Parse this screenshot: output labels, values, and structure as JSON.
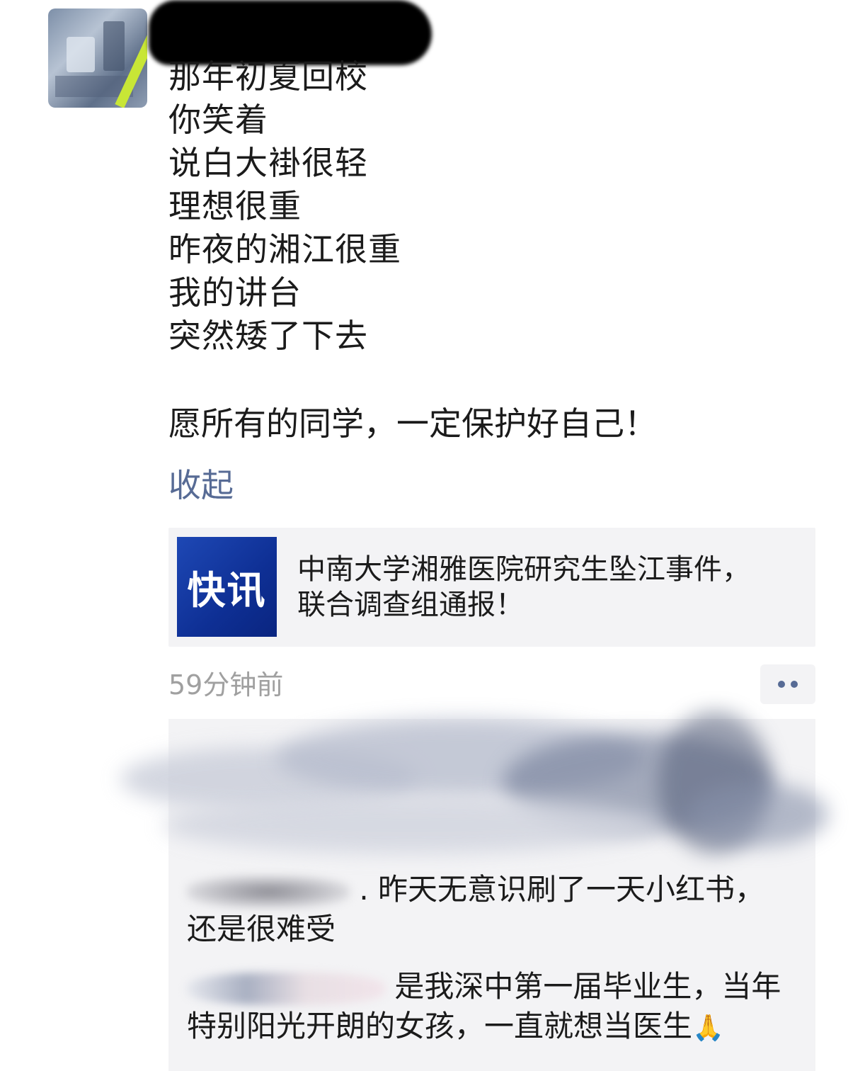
{
  "post": {
    "poem_lines": [
      "那年初夏回校",
      "你笑着",
      "说白大褂很轻",
      "理想很重",
      "昨夜的湘江很重",
      "我的讲台",
      "突然矮了下去"
    ],
    "wish": "愿所有的同学，一定保护好自己！",
    "collapse_label": "收起",
    "time_ago": "59分钟前"
  },
  "link_card": {
    "thumb_text": "快讯",
    "title_line1": "中南大学湘雅医院研究生坠江事件，",
    "title_line2": "联合调查组通报！"
  },
  "comments": [
    {
      "text_line1": ". 昨天无意识刷了一天小红书，",
      "text_line2": "还是很难受"
    },
    {
      "text_line1": "是我深中第一届毕业生，当年",
      "text_line2": "特别阳光开朗的女孩，一直就想当医生",
      "emoji": "🙏"
    }
  ],
  "icons": [
    "more-dots-icon",
    "pray-emoji-icon"
  ],
  "colors": {
    "link_blue": "#576b95",
    "time_gray": "#a0a0a0",
    "card_bg": "#f3f3f5",
    "kx_blue": "#1e48b5"
  }
}
